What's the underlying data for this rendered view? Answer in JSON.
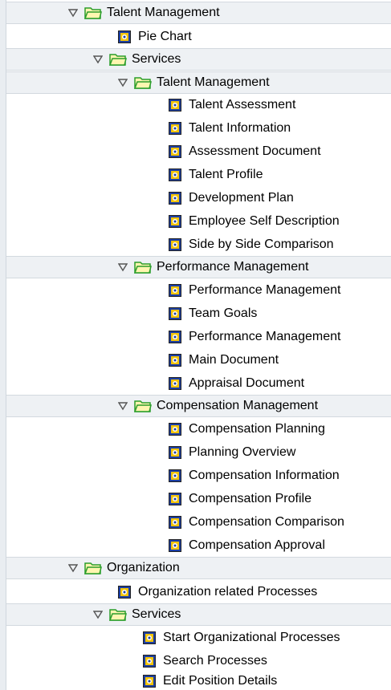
{
  "tree": [
    {
      "label": "Talent Management",
      "type": "folder"
    },
    {
      "label": "Pie Chart",
      "type": "leaf"
    },
    {
      "label": "Services",
      "type": "folder"
    },
    {
      "label": "Talent Management",
      "type": "folder"
    },
    {
      "label": "Talent Assessment",
      "type": "leaf"
    },
    {
      "label": "Talent Information",
      "type": "leaf"
    },
    {
      "label": "Assessment Document",
      "type": "leaf"
    },
    {
      "label": "Talent Profile",
      "type": "leaf"
    },
    {
      "label": "Development Plan",
      "type": "leaf"
    },
    {
      "label": "Employee Self Description",
      "type": "leaf"
    },
    {
      "label": "Side by Side Comparison",
      "type": "leaf"
    },
    {
      "label": "Performance Management",
      "type": "folder"
    },
    {
      "label": "Performance Management",
      "type": "leaf"
    },
    {
      "label": "Team Goals",
      "type": "leaf"
    },
    {
      "label": "Performance Management",
      "type": "leaf"
    },
    {
      "label": "Main Document",
      "type": "leaf"
    },
    {
      "label": "Appraisal Document",
      "type": "leaf"
    },
    {
      "label": "Compensation Management",
      "type": "folder"
    },
    {
      "label": "Compensation Planning",
      "type": "leaf"
    },
    {
      "label": "Planning Overview",
      "type": "leaf"
    },
    {
      "label": "Compensation Information",
      "type": "leaf"
    },
    {
      "label": "Compensation Profile",
      "type": "leaf"
    },
    {
      "label": "Compensation Comparison",
      "type": "leaf"
    },
    {
      "label": "Compensation Approval",
      "type": "leaf"
    },
    {
      "label": "Organization",
      "type": "folder"
    },
    {
      "label": "Organization related Processes",
      "type": "leaf"
    },
    {
      "label": "Services",
      "type": "folder"
    },
    {
      "label": "Start Organizational Processes",
      "type": "leaf"
    },
    {
      "label": "Search Processes",
      "type": "leaf"
    },
    {
      "label": "Edit Position Details",
      "type": "leaf"
    }
  ],
  "colors": {
    "folder_fill": "#fff6b0",
    "folder_outline": "#2a9d2a",
    "leaf_bg": "#1c3fa3",
    "leaf_frame": "#f2c40b"
  },
  "icons": {
    "folder": "open-folder-icon",
    "leaf": "service-document-icon",
    "expander": "expanded-triangle-icon"
  }
}
